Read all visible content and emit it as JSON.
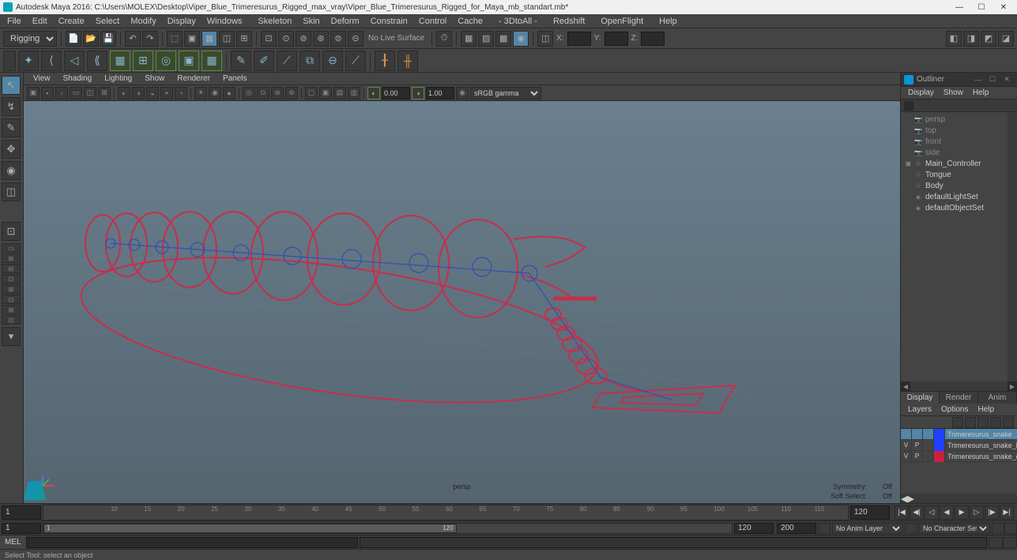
{
  "titlebar": {
    "app": "Autodesk Maya 2016:",
    "path": "C:\\Users\\MOLEX\\Desktop\\Viper_Blue_Trimeresurus_Rigged_max_vray\\Viper_Blue_Trimeresurus_Rigged_for_Maya_mb_standart.mb*"
  },
  "menubar": [
    "File",
    "Edit",
    "Create",
    "Select",
    "Modify",
    "Display",
    "Windows",
    "Skeleton",
    "Skin",
    "Deform",
    "Constrain",
    "Control",
    "Cache",
    "- 3DtoAll -",
    "Redshift",
    "OpenFlight",
    "Help"
  ],
  "statusline": {
    "mode": "Rigging",
    "livesurface": "No Live Surface",
    "coords": [
      "X:",
      "Y:",
      "Z:"
    ]
  },
  "panel_menu": [
    "View",
    "Shading",
    "Lighting",
    "Show",
    "Renderer",
    "Panels"
  ],
  "panel_toolbar": {
    "near": "0.00",
    "far": "1.00",
    "colorspace": "sRGB gamma"
  },
  "viewport": {
    "camera": "persp",
    "symmetry_label": "Symmetry:",
    "symmetry_value": "Off",
    "softselect_label": "Soft Select:",
    "softselect_value": "Off"
  },
  "outliner": {
    "title": "Outliner",
    "menu": [
      "Display",
      "Show",
      "Help"
    ],
    "nodes": [
      {
        "name": "persp",
        "icon": "cam",
        "dim": true
      },
      {
        "name": "top",
        "icon": "cam",
        "dim": true
      },
      {
        "name": "front",
        "icon": "cam",
        "dim": true
      },
      {
        "name": "side",
        "icon": "cam",
        "dim": true
      },
      {
        "name": "Main_Controller",
        "icon": "xform",
        "dim": false,
        "expandable": true
      },
      {
        "name": "Tongue",
        "icon": "xform",
        "dim": false
      },
      {
        "name": "Body",
        "icon": "xform",
        "dim": false
      },
      {
        "name": "defaultLightSet",
        "icon": "set",
        "dim": false
      },
      {
        "name": "defaultObjectSet",
        "icon": "set",
        "dim": false
      }
    ]
  },
  "layers": {
    "tabs": [
      "Display",
      "Render",
      "Anim"
    ],
    "menu": [
      "Layers",
      "Options",
      "Help"
    ],
    "rows": [
      {
        "v": "",
        "p": "",
        "color": "#2040ff",
        "name": "Trimeresurus_snake",
        "selected": true
      },
      {
        "v": "V",
        "p": "P",
        "color": "#2040ff",
        "name": "Trimeresurus_snake_bo",
        "selected": false
      },
      {
        "v": "V",
        "p": "P",
        "color": "#cc2040",
        "name": "Trimeresurus_snake_co",
        "selected": false
      }
    ]
  },
  "timeline": {
    "current": "1",
    "end_visible": "120",
    "ticks": [
      "10",
      "15",
      "20",
      "25",
      "30",
      "35",
      "40",
      "45",
      "50",
      "55",
      "60",
      "65",
      "70",
      "75",
      "80",
      "85",
      "90",
      "95",
      "100",
      "105",
      "110",
      "115"
    ]
  },
  "rangeslider": {
    "start": "1",
    "handle_start": "1",
    "handle_end": "120",
    "end": "120",
    "total": "200",
    "animlayer": "No Anim Layer",
    "charset": "No Character Set"
  },
  "cmdline": {
    "label": "MEL"
  },
  "helpline": "Select Tool: select an object"
}
